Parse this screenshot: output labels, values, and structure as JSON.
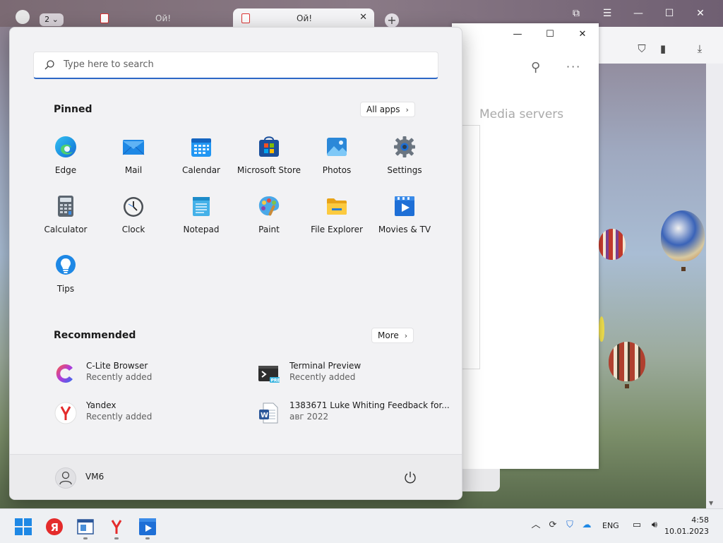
{
  "browser": {
    "tab_count": "2",
    "tabs": [
      {
        "label": "Ой!"
      },
      {
        "label": "Ой!",
        "close": "✕"
      }
    ],
    "new_tab": "+"
  },
  "app_window": {
    "heading": "Media servers"
  },
  "start_menu": {
    "search": {
      "placeholder": "Type here to search"
    },
    "pinned": {
      "title": "Pinned",
      "all_apps_label": "All apps",
      "apps": [
        {
          "name": "Edge",
          "icon": "edge-icon"
        },
        {
          "name": "Mail",
          "icon": "mail-icon"
        },
        {
          "name": "Calendar",
          "icon": "calendar-icon"
        },
        {
          "name": "Microsoft Store",
          "icon": "store-icon"
        },
        {
          "name": "Photos",
          "icon": "photos-icon"
        },
        {
          "name": "Settings",
          "icon": "gear-icon"
        },
        {
          "name": "Calculator",
          "icon": "calculator-icon"
        },
        {
          "name": "Clock",
          "icon": "clock-icon"
        },
        {
          "name": "Notepad",
          "icon": "notepad-icon"
        },
        {
          "name": "Paint",
          "icon": "paint-icon"
        },
        {
          "name": "File Explorer",
          "icon": "folder-icon"
        },
        {
          "name": "Movies & TV",
          "icon": "play-icon"
        },
        {
          "name": "Tips",
          "icon": "lightbulb-icon"
        }
      ]
    },
    "recommended": {
      "title": "Recommended",
      "more_label": "More",
      "items": [
        {
          "title": "C-Lite Browser",
          "subtitle": "Recently added",
          "icon": "c-lite-icon"
        },
        {
          "title": "Terminal Preview",
          "subtitle": "Recently added",
          "icon": "terminal-icon"
        },
        {
          "title": "Yandex",
          "subtitle": "Recently added",
          "icon": "yandex-icon"
        },
        {
          "title": "1383671 Luke Whiting Feedback for...",
          "subtitle": "авг 2022",
          "icon": "word-doc-icon"
        }
      ]
    },
    "user": {
      "name": "VM6"
    }
  },
  "taskbar": {
    "language": "ENG",
    "time": "4:58",
    "date": "10.01.2023"
  },
  "colors": {
    "accent": "#2c67c6",
    "start_bg": "#f2f2f4",
    "taskbar_bg": "#eef0f3"
  }
}
